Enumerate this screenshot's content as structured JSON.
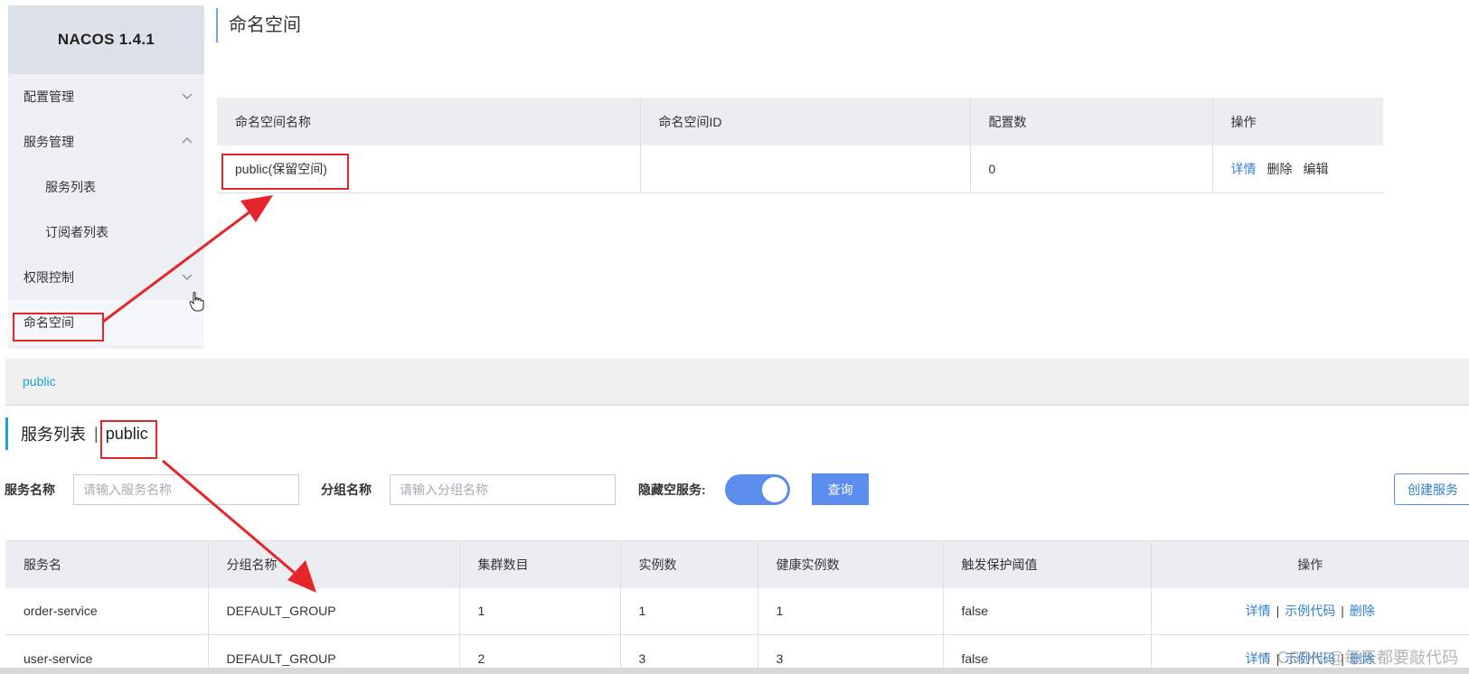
{
  "sidebar": {
    "logo": "NACOS 1.4.1",
    "items": [
      {
        "label": "配置管理",
        "chevron": "down"
      },
      {
        "label": "服务管理",
        "chevron": "up"
      },
      {
        "label": "服务列表"
      },
      {
        "label": "订阅者列表"
      },
      {
        "label": "权限控制",
        "chevron": "down"
      },
      {
        "label": "命名空间"
      }
    ]
  },
  "namespace_page": {
    "title": "命名空间",
    "columns": [
      "命名空间名称",
      "命名空间ID",
      "配置数",
      "操作"
    ],
    "rows": [
      {
        "name": "public(保留空间)",
        "id": "",
        "config_count": "0",
        "actions": [
          "详情",
          "删除",
          "编辑"
        ]
      }
    ]
  },
  "service_page": {
    "namespace_tab": "public",
    "title": "服务列表",
    "separator": "|",
    "namespace": "public",
    "filters": {
      "service_name_label": "服务名称",
      "service_name_placeholder": "请输入服务名称",
      "group_name_label": "分组名称",
      "group_name_placeholder": "请输入分组名称",
      "hide_empty_label": "隐藏空服务:",
      "hide_empty_on": true
    },
    "query_button": "查询",
    "create_button": "创建服务",
    "columns": [
      "服务名",
      "分组名称",
      "集群数目",
      "实例数",
      "健康实例数",
      "触发保护阈值",
      "操作"
    ],
    "rows": [
      {
        "service": "order-service",
        "group": "DEFAULT_GROUP",
        "clusters": "1",
        "instances": "1",
        "healthy": "1",
        "threshold": "false",
        "actions": [
          "详情",
          "示例代码",
          "删除"
        ]
      },
      {
        "service": "user-service",
        "group": "DEFAULT_GROUP",
        "clusters": "2",
        "instances": "3",
        "healthy": "3",
        "threshold": "false",
        "actions": [
          "详情",
          "示例代码",
          "删除"
        ]
      }
    ]
  },
  "watermark": "CSDN @每天都要敲代码",
  "colors": {
    "accent": "#5b8def",
    "link": "#2f7fd1",
    "annotation": "#e5252a"
  }
}
